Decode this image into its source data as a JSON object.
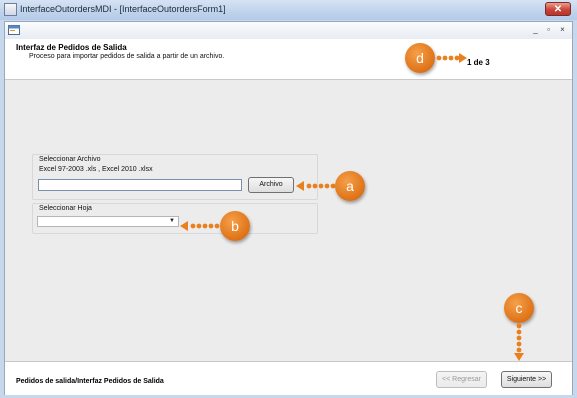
{
  "window": {
    "title": "InterfaceOutordersMDI - [InterfaceOutordersForm1]",
    "close_glyph": "✕"
  },
  "mdi": {
    "minimize_glyph": "_",
    "restore_glyph": "▫",
    "close_glyph": "×"
  },
  "header": {
    "title": "Interfaz de Pedidos de Salida",
    "subtitle": "Proceso para importar pedidos de salida a partir de un archivo.",
    "step": "1 de 3"
  },
  "file_group": {
    "label": "Seleccionar Archivo",
    "formats": "Excel 97-2003 .xls , Excel 2010 .xlsx",
    "path_value": "",
    "browse_label": "Archivo"
  },
  "sheet_group": {
    "label": "Seleccionar Hoja",
    "selected": ""
  },
  "footer": {
    "title": "Pedidos de salida/Interfaz Pedidos de Salida",
    "back_label": "<< Regresar",
    "next_label": "Siguiente >>"
  },
  "callouts": {
    "a": "a",
    "b": "b",
    "c": "c",
    "d": "d"
  },
  "colors": {
    "callout": "#e0751a",
    "frame": "#c7d7ec",
    "panel": "#ececec"
  }
}
